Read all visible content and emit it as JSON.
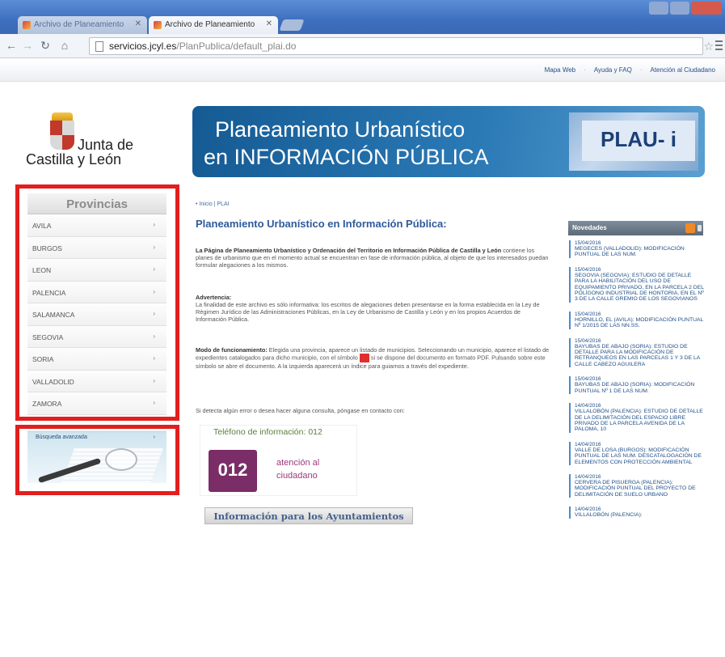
{
  "browser": {
    "tabs": [
      {
        "title": "Archivo de Planeamiento",
        "active": false
      },
      {
        "title": "Archivo de Planeamiento",
        "active": true
      }
    ],
    "url_host": "servicios.jcyl.es",
    "url_path": "/PlanPublica/default_plai.do"
  },
  "utility_links": [
    "Mapa Web",
    "Ayuda y FAQ",
    "Atención al Ciudadano"
  ],
  "logo": {
    "line1": "Junta de",
    "line2": "Castilla y León"
  },
  "banner": {
    "line1": "Planeamiento Urbanístico",
    "line2": "en INFORMACIÓN PÚBLICA",
    "badge": "PLAU- i"
  },
  "sidebar": {
    "title": "Provincias",
    "items": [
      "AVILA",
      "BURGOS",
      "LEON",
      "PALENCIA",
      "SALAMANCA",
      "SEGOVIA",
      "SORIA",
      "VALLADOLID",
      "ZAMORA"
    ],
    "arrow": "›",
    "advanced_search": "Búsqueda avanzada"
  },
  "breadcrumb": "• Inicio | PLAI",
  "main": {
    "title": "Planeamiento Urbanístico en Información Pública:",
    "p1_bold": "La Página de Planeamiento Urbanístico y Ordenación del Territorio en Información Pública de Castilla y León",
    "p1_rest": " contiene los planes de urbanismo que en el momento actual se encuentran en fase de información pública, al objeto de que los interesados puedan formular alegaciones a los mismos.",
    "p2_bold": "Advertencia:",
    "p2_rest": "La finalidad de este archivo es sólo informativa: los escritos de alegaciones deben presentarse en la forma establecida en la Ley de Régimen Jurídico de las Administraciones Públicas, en la Ley de Urbanismo de Castilla y León y en los propios Acuerdos de Información Pública.",
    "p3_bold": "Modo de funcionamiento:",
    "p3_a": " Elegida una provincia, aparece un listado de municipios. Seleccionando un municipio, aparece el listado de expedientes catalogados para dicho municipio, con el símbolo ",
    "p3_b": " si se dispone del documento en formato PDF. Pulsando sobre este símbolo se abre el documento. A la izquierda aparecerá un índice para guiarnos a través del expediente.",
    "p4": "Si detecta algún error o desea hacer alguna consulta, póngase en contacto con:",
    "phone_title": "Teléfono de información: 012",
    "phone_logo": "012",
    "phone_line1": "atención al",
    "phone_line2": "ciudadano",
    "ayto_button": "Información para los Ayuntamientos"
  },
  "novedades": {
    "title": "Novedades",
    "items": [
      {
        "date": "15/04/2016",
        "text": "MEGECES (VALLADOLID): MODIFICACIÓN PUNTUAL DE LAS NUM."
      },
      {
        "date": "15/04/2016",
        "text": "SEGOVIA (SEGOVIA): ESTUDIO DE DETALLE PARA LA HABILITACIÓN DEL USO DE EQUIPAMIENTO PRIVADO, EN LA PARCELA 2 DEL POLÍGONO INDUSTRIAL DE HONTORIA, EN EL Nº 3 DE LA CALLE GREMIO DE LOS SEGOVIANOS"
      },
      {
        "date": "15/04/2016",
        "text": "HORNILLO, EL (AVILA): MODIFICACIÓN PUNTUAL Nº 1/2015 DE LAS NN.SS."
      },
      {
        "date": "15/04/2016",
        "text": "BAYUBAS DE ABAJO (SORIA): ESTUDIO DE DETALLE PARA LA MODIFICACIÓN DE RETRANQUEOS EN LAS PARCELAS 1 Y 3 DE LA CALLE CABEZO AGUILERA"
      },
      {
        "date": "15/04/2016",
        "text": "BAYUBAS DE ABAJO (SORIA): MODIFICACIÓN PUNTUAL Nº 1 DE LAS NUM."
      },
      {
        "date": "14/04/2016",
        "text": "VILLALOBÓN (PALENCIA): ESTUDIO DE DETALLE DE LA DELIMITACIÓN DEL ESPACIO LIBRE PRIVADO DE LA PARCELA AVENIDA DE LA PALOMA, 10"
      },
      {
        "date": "14/04/2016",
        "text": "VALLE DE LOSA (BURGOS): MODIFICACIÓN PUNTUAL DE LAS NUM. DESCATALOGACIÓN DE ELEMENTOS CON PROTECCIÓN AMBIENTAL"
      },
      {
        "date": "14/04/2016",
        "text": "CERVERA DE PISUERGA (PALENCIA): MODIFICACIÓN PUNTUAL DEL PROYECTO DE DELIMITACIÓN DE SUELO URBANO"
      },
      {
        "date": "14/04/2016",
        "text": "VILLALOBÓN (PALENCIA):"
      }
    ]
  },
  "colors": {
    "highlight": "#e31e1e",
    "banner": "#2a79b5",
    "link": "#2e5a9a"
  }
}
